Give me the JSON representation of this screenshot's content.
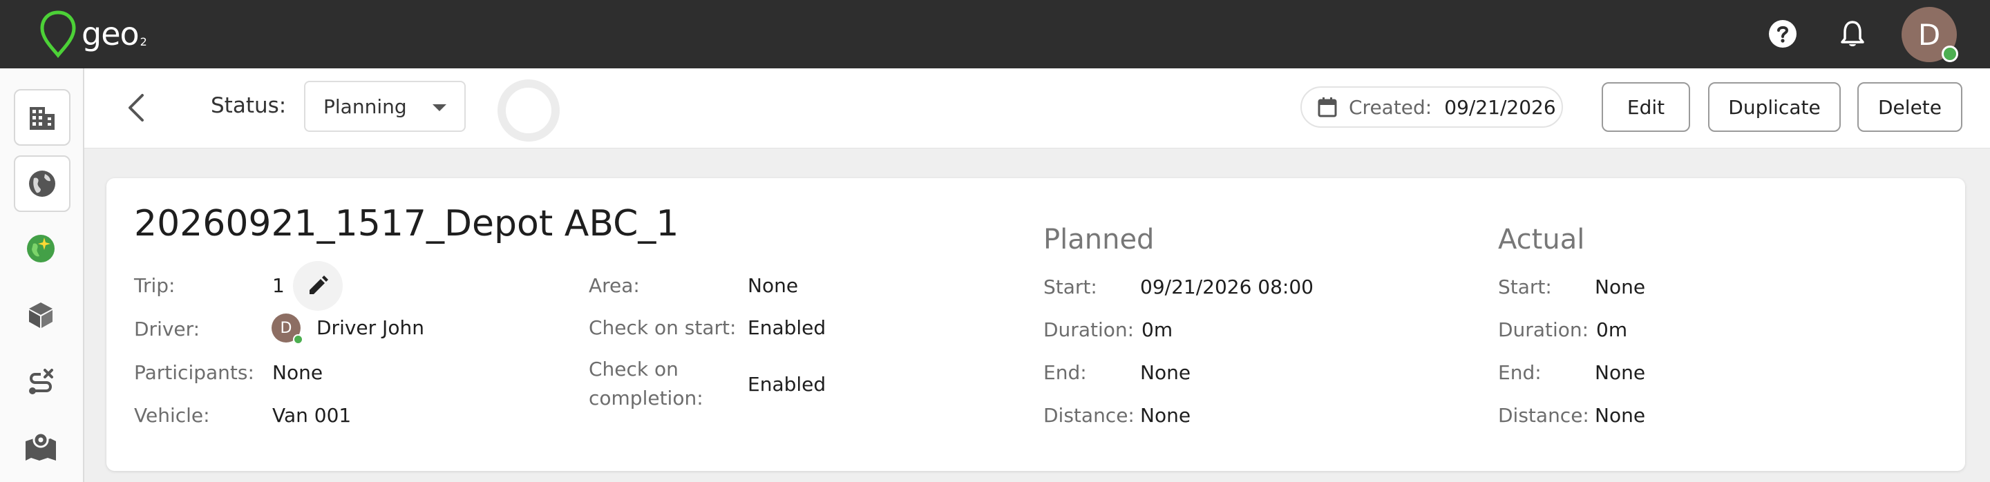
{
  "header": {
    "logo_text": "geo",
    "logo_sub": "2",
    "help_icon": "help-circle-icon",
    "notifications_icon": "bell-icon",
    "user_initial": "D",
    "brand_color": "#4cd137"
  },
  "sidebar": {
    "items": [
      {
        "icon": "building-icon"
      },
      {
        "icon": "globe-icon"
      },
      {
        "icon": "sparkle-globe-icon"
      },
      {
        "icon": "package-icon"
      },
      {
        "icon": "route-icon"
      },
      {
        "icon": "map-icon"
      }
    ]
  },
  "toolbar": {
    "status_label": "Status:",
    "status_value": "Planning",
    "created_label": "Created:",
    "created_value": "09/21/2026",
    "edit_label": "Edit",
    "duplicate_label": "Duplicate",
    "delete_label": "Delete"
  },
  "trip": {
    "title": "20260921_1517_Depot ABC_1",
    "trip_label": "Trip:",
    "trip_value": "1",
    "driver_label": "Driver:",
    "driver_initial": "D",
    "driver_value": "Driver John",
    "participants_label": "Participants:",
    "participants_value": "None",
    "vehicle_label": "Vehicle:",
    "vehicle_value": "Van 001",
    "area_label": "Area:",
    "area_value": "None",
    "check_start_label": "Check on start:",
    "check_start_value": "Enabled",
    "check_completion_label_1": "Check on",
    "check_completion_label_2": "completion:",
    "check_completion_value": "Enabled"
  },
  "planned": {
    "heading": "Planned",
    "start_label": "Start:",
    "start_value": "09/21/2026 08:00",
    "duration_label": "Duration:",
    "duration_value": "0m",
    "end_label": "End:",
    "end_value": "None",
    "distance_label": "Distance:",
    "distance_value": "None"
  },
  "actual": {
    "heading": "Actual",
    "start_label": "Start:",
    "start_value": "None",
    "duration_label": "Duration:",
    "duration_value": "0m",
    "end_label": "End:",
    "end_value": "None",
    "distance_label": "Distance:",
    "distance_value": "None"
  }
}
